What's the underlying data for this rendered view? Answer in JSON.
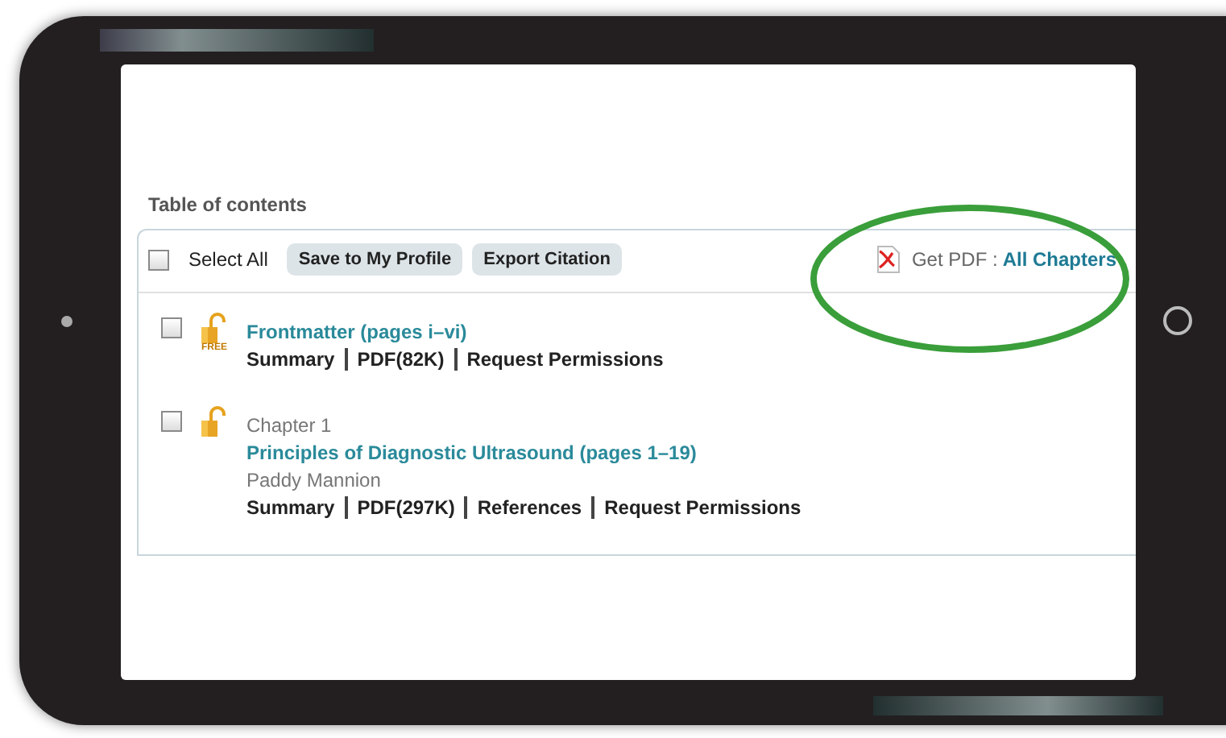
{
  "toc": {
    "title": "Table of contents",
    "toolbar": {
      "select_all": {
        "label": "Select All",
        "checked": false
      },
      "buttons": [
        "Save to My Profile",
        "Export Citation"
      ],
      "get_pdf": {
        "label": "Get PDF :",
        "link": "All Chapters"
      }
    },
    "entries": [
      {
        "checked": false,
        "badge": "FREE",
        "title": "Frontmatter (pages i–vi)",
        "links": [
          "Summary",
          "PDF(82K)",
          "Request Permissions"
        ]
      },
      {
        "checked": false,
        "chapter": "Chapter 1",
        "title": "Principles of Diagnostic Ultrasound (pages 1–19)",
        "author": "Paddy Mannion",
        "links": [
          "Summary",
          "PDF(297K)",
          "References",
          "Request Permissions"
        ]
      }
    ]
  }
}
